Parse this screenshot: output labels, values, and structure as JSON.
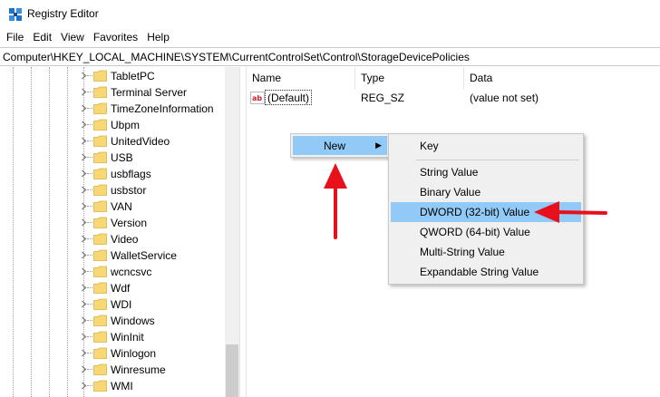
{
  "window": {
    "title": "Registry Editor"
  },
  "menubar": {
    "items": [
      "File",
      "Edit",
      "View",
      "Favorites",
      "Help"
    ]
  },
  "address": {
    "value": "Computer\\HKEY_LOCAL_MACHINE\\SYSTEM\\CurrentControlSet\\Control\\StorageDevicePolicies"
  },
  "tree": {
    "items": [
      "TabletPC",
      "Terminal Server",
      "TimeZoneInformation",
      "Ubpm",
      "UnitedVideo",
      "USB",
      "usbflags",
      "usbstor",
      "VAN",
      "Version",
      "Video",
      "WalletService",
      "wcncsvc",
      "Wdf",
      "WDI",
      "Windows",
      "WinInit",
      "Winlogon",
      "Winresume",
      "WMI"
    ]
  },
  "values": {
    "columns": [
      "Name",
      "Type",
      "Data"
    ],
    "rows": [
      {
        "name": "(Default)",
        "type": "REG_SZ",
        "data": "(value not set)"
      }
    ]
  },
  "context_menu": {
    "new_label": "New",
    "submenu": [
      "Key",
      "String Value",
      "Binary Value",
      "DWORD (32-bit) Value",
      "QWORD (64-bit) Value",
      "Multi-String Value",
      "Expandable String Value"
    ],
    "highlighted": "DWORD (32-bit) Value"
  },
  "colors": {
    "highlight": "#91c9f7",
    "menu_bg": "#f0f0f0",
    "annotation_arrow": "#e8101b",
    "folder": "#f8d775"
  }
}
